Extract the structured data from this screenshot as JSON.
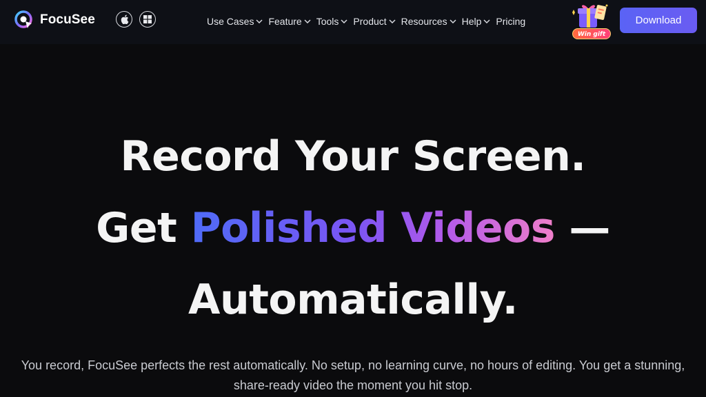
{
  "brand": {
    "name": "FocuSee"
  },
  "platforms": {
    "apple_icon": "apple-icon",
    "windows_icon": "windows-icon"
  },
  "nav": {
    "items": [
      {
        "label": "Use Cases",
        "dropdown": true
      },
      {
        "label": "Feature",
        "dropdown": true
      },
      {
        "label": "Tools",
        "dropdown": true
      },
      {
        "label": "Product",
        "dropdown": true
      },
      {
        "label": "Resources",
        "dropdown": true
      },
      {
        "label": "Help",
        "dropdown": true
      },
      {
        "label": "Pricing",
        "dropdown": false
      }
    ]
  },
  "promo": {
    "badge": "Win gift"
  },
  "cta": {
    "download_label": "Download"
  },
  "hero": {
    "line1": "Record Your Screen.",
    "line2_prefix": "Get ",
    "line2_highlight": "Polished Videos",
    "line2_suffix": " —",
    "line3": "Automatically.",
    "subtitle": "You record, FocuSee perfects the rest automatically. No setup, no learning curve, no hours of editing. You get a stunning, share-ready video the moment you hit stop."
  },
  "colors": {
    "navbar_bg": "#0e1016",
    "page_bg": "#0b0b0d",
    "accent_button": "#5a63f5",
    "gradient_start": "#4f6bf7",
    "gradient_mid": "#b25ae9",
    "gradient_end": "#f07fc9"
  }
}
